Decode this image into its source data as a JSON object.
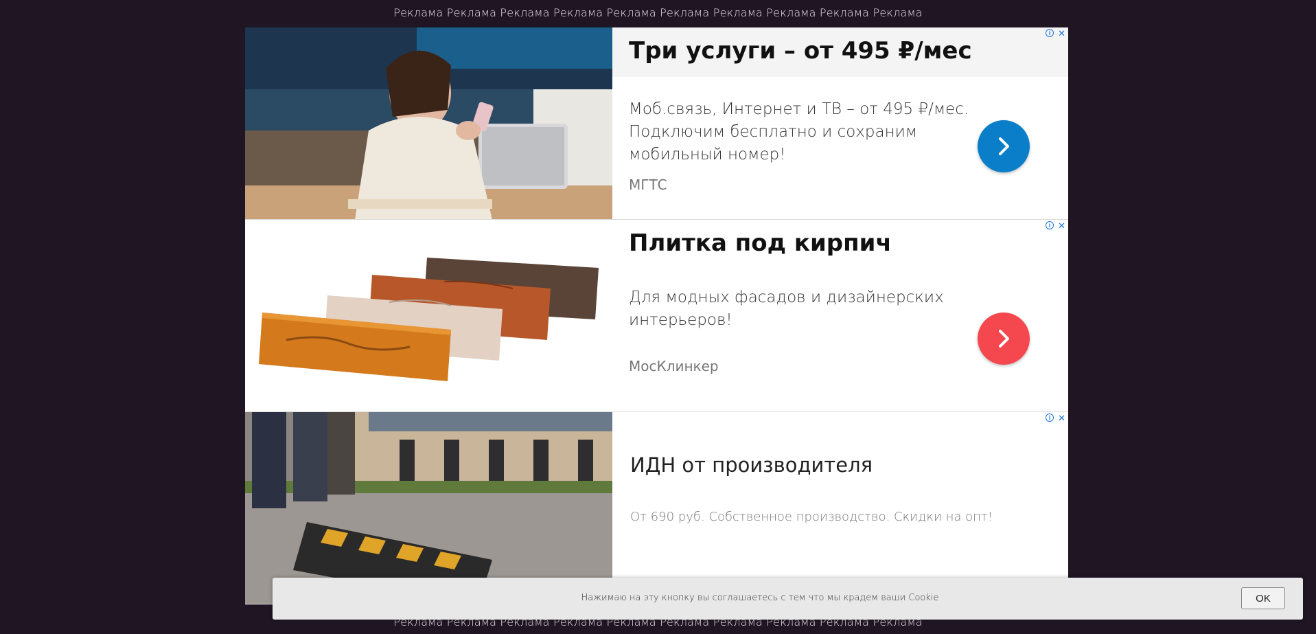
{
  "ad_strip_top": "Реклама Реклама Реклама Реклама Реклама Реклама Реклама Реклама Реклама Реклама",
  "ad_strip_bottom": "Реклама Реклама Реклама Реклама Реклама Реклама Реклама Реклама Реклама Реклама",
  "ads": [
    {
      "title": "Три услуги – от 495 ₽/мес",
      "description": "Моб.связь, Интернет и ТВ – от 495 ₽/мес. Подключим бесплатно и сохраним мобильный номер!",
      "domain": "МГТС",
      "button_color": "#0b7ec9",
      "image": "woman-with-phone-photo"
    },
    {
      "title": "Плитка под кирпич",
      "description": "Для модных фасадов и дизайнерских интерьеров!",
      "domain": "МосКлинкер",
      "button_color": "#f5484e",
      "image": "brick-tiles-photo"
    },
    {
      "title": "ИДН от производителя",
      "description": "От 690 руб. Собственное производство. Скидки на опт!",
      "image": "speed-bump-installation-photo"
    }
  ],
  "ad_badges": {
    "info": "i",
    "close": "✕"
  },
  "cookie": {
    "text": "Нажимаю на эту кнопку вы соглашаетесь с тем что мы крадем ваши Cookie",
    "button_label": "OK"
  }
}
